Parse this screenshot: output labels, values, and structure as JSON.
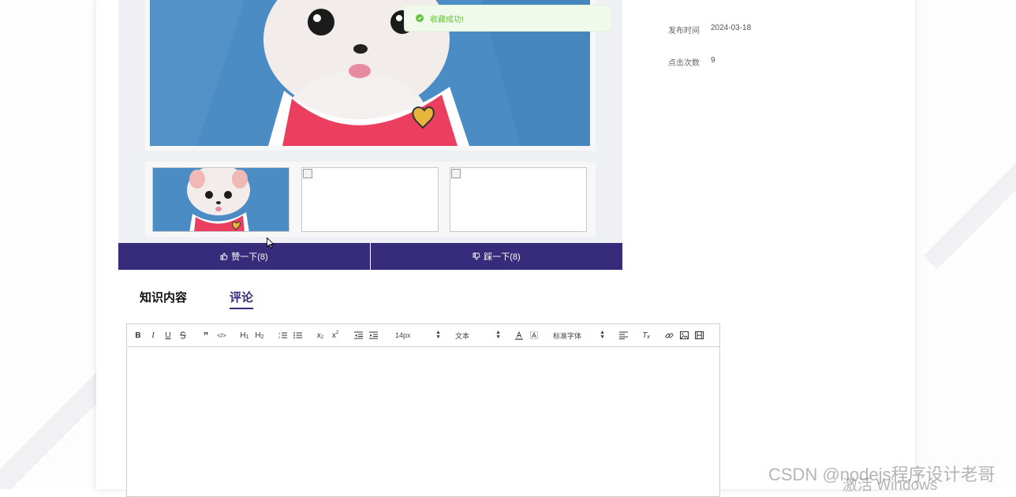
{
  "toast": {
    "message": "收藏成功!"
  },
  "meta": [
    {
      "label": "发布时间",
      "value": "2024-03-18"
    },
    {
      "label": "点击次数",
      "value": "9"
    }
  ],
  "actions": {
    "like_label": "赞一下(8)",
    "dislike_label": "踩一下(8)"
  },
  "tabs": [
    {
      "label": "知识内容"
    },
    {
      "label": "评论"
    }
  ],
  "toolbar": {
    "font_size": "14px",
    "header_select": "文本",
    "font_family": "标准字体",
    "icons": [
      "bold-icon",
      "italic-icon",
      "underline-icon",
      "strikethrough-icon",
      "blockquote-icon",
      "code-block-icon",
      "header-1-icon",
      "header-2-icon",
      "ordered-list-icon",
      "bullet-list-icon",
      "subscript-icon",
      "superscript-icon",
      "outdent-icon",
      "indent-icon",
      "font-color-icon",
      "background-color-icon",
      "align-icon",
      "clear-format-icon",
      "link-icon",
      "image-icon",
      "video-icon"
    ]
  },
  "watermark": {
    "csdn": "CSDN @nodejs程序设计老哥",
    "windows": "激活 Windows"
  },
  "colors": {
    "accent": "#372c7c",
    "success": "#67c23a"
  }
}
